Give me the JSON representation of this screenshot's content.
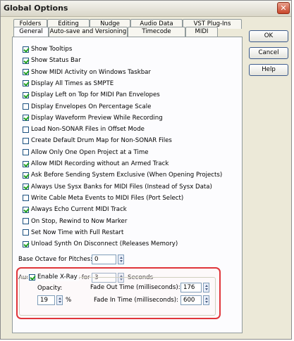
{
  "window": {
    "title": "Global Options",
    "close_glyph": "✕"
  },
  "tabs": {
    "row_back": [
      "Folders",
      "Editing",
      "Nudge",
      "Audio Data",
      "VST Plug-Ins"
    ],
    "row_front": [
      "General",
      "Auto-save and Versioning",
      "Timecode",
      "MIDI"
    ],
    "active": "General"
  },
  "options": [
    {
      "label": "Show Tooltips",
      "checked": true
    },
    {
      "label": "Show Status Bar",
      "checked": true
    },
    {
      "label": "Show MIDI Activity on Windows Taskbar",
      "checked": true
    },
    {
      "label": "Display All Times as SMPTE",
      "checked": true
    },
    {
      "label": "Display Left on Top for MIDI Pan Envelopes",
      "checked": true
    },
    {
      "label": "Display Envelopes On Percentage Scale",
      "checked": false
    },
    {
      "label": "Display Waveform Preview While Recording",
      "checked": true
    },
    {
      "label": "Load Non-SONAR Files in Offset Mode",
      "checked": false
    },
    {
      "label": "Create Default Drum Map for Non-SONAR Files",
      "checked": false
    },
    {
      "label": "Allow Only One Open Project at a Time",
      "checked": false
    },
    {
      "label": "Allow MIDI Recording without an Armed Track",
      "checked": true
    },
    {
      "label": "Ask Before Sending System Exclusive (When Opening Projects)",
      "checked": true
    },
    {
      "label": "Always Use Sysx Banks for MIDI Files (Instead of Sysx Data)",
      "checked": true
    },
    {
      "label": "Write Cable Meta Events to MIDI Files (Port Select)",
      "checked": false
    },
    {
      "label": "Always Echo Current MIDI Track",
      "checked": true
    },
    {
      "label": "On Stop, Rewind to Now Marker",
      "checked": false
    },
    {
      "label": "Set Now Time with Full Restart",
      "checked": false
    },
    {
      "label": "Unload Synth On Disconnect (Releases Memory)",
      "checked": true
    }
  ],
  "base_octave": {
    "label": "Base Octave for Pitches:",
    "value": "0"
  },
  "audition": {
    "label": "Audition Commands for",
    "value": "3",
    "unit": "Seconds"
  },
  "xray": {
    "enable_label": "Enable X-Ray",
    "enabled": true,
    "opacity_label": "Opacity:",
    "opacity_value": "19",
    "opacity_unit": "%",
    "fade_out_label": "Fade Out Time (milliseconds):",
    "fade_out_value": "176",
    "fade_in_label": "Fade In Time (milliseconds):",
    "fade_in_value": "600",
    "highlight_color": "#e0353a"
  },
  "buttons": {
    "ok": "OK",
    "cancel": "Cancel",
    "help": "Help"
  }
}
